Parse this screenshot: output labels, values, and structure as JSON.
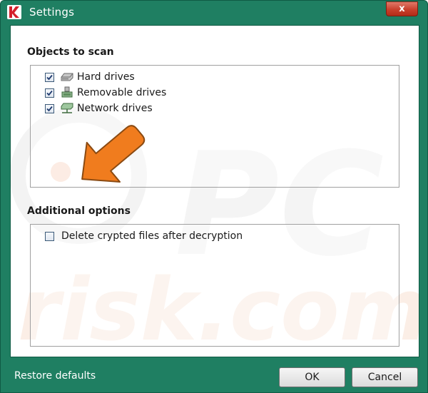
{
  "window": {
    "title": "Settings",
    "close_symbol": "x"
  },
  "objects_section": {
    "title": "Objects to scan",
    "items": [
      {
        "label": "Hard drives",
        "checked": true,
        "icon": "hard-drive-icon"
      },
      {
        "label": "Removable drives",
        "checked": true,
        "icon": "removable-drive-icon"
      },
      {
        "label": "Network drives",
        "checked": true,
        "icon": "network-drive-icon"
      }
    ]
  },
  "options_section": {
    "title": "Additional options",
    "items": [
      {
        "label": "Delete crypted files after decryption",
        "checked": false
      }
    ]
  },
  "footer": {
    "restore_label": "Restore defaults",
    "ok_label": "OK",
    "cancel_label": "Cancel"
  },
  "colors": {
    "frame": "#1f7f62",
    "close": "#c9402c",
    "annotation_arrow": "#f07c1e"
  }
}
